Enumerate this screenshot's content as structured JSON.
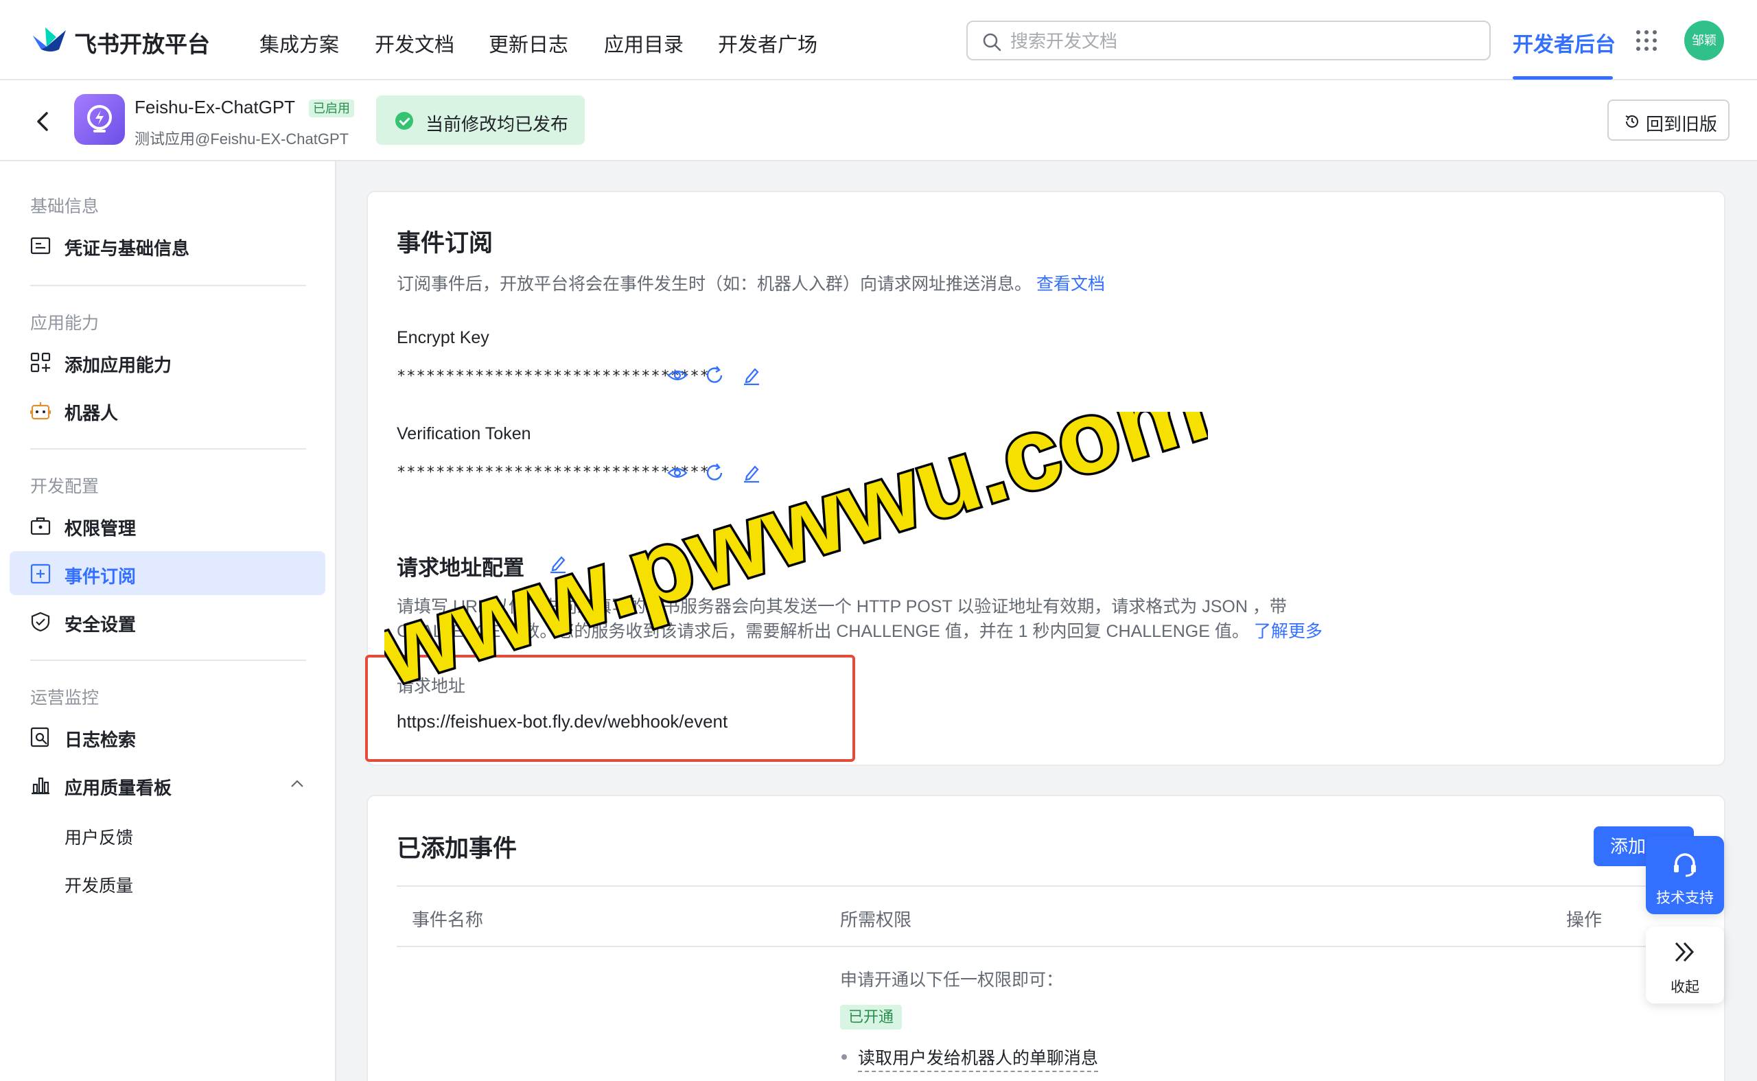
{
  "nav": {
    "brand": "飞书开放平台",
    "items": [
      "集成方案",
      "开发文档",
      "更新日志",
      "应用目录",
      "开发者广场"
    ],
    "search_placeholder": "搜索开发文档",
    "dev_console": "开发者后台",
    "avatar_text": "邹颖"
  },
  "app": {
    "name": "Feishu-Ex-ChatGPT",
    "badge": "已启用",
    "subtitle": "测试应用@Feishu-EX-ChatGPT",
    "status": "当前修改均已发布",
    "old_version": "回到旧版"
  },
  "sidebar": {
    "groups": [
      "基础信息",
      "应用能力",
      "开发配置",
      "运营监控"
    ],
    "items": [
      "凭证与基础信息",
      "添加应用能力",
      "机器人",
      "权限管理",
      "事件订阅",
      "安全设置",
      "日志检索",
      "应用质量看板"
    ],
    "subitems": [
      "用户反馈",
      "开发质量"
    ]
  },
  "event_sub": {
    "title": "事件订阅",
    "desc": "订阅事件后，开放平台将会在事件发生时（如：机器人入群）向请求网址推送消息。",
    "doc_link": "查看文档",
    "encrypt_label": "Encrypt Key",
    "encrypt_mask": "********************************",
    "token_label": "Verification Token",
    "token_mask": "********************************",
    "request_title": "请求地址配置",
    "request_desc1": "请填写 URL 以便飞书向您填写的飞书服务器会向其发送一个 HTTP POST 以验证地址有效期，请求格式为 JSON ，带",
    "request_desc2": "CHALLENGE 参数。您的服务收到该请求后，需要解析出 CHALLENGE 值，并在 1 秒内回复 CHALLENGE 值。",
    "learn_more": "了解更多",
    "url_label": "请求地址",
    "url_value": "https://feishuex-bot.fly.dev/webhook/event"
  },
  "events": {
    "title": "已添加事件",
    "add_button": "添加",
    "columns": [
      "事件名称",
      "所需权限",
      "操作"
    ],
    "perm_intro": "申请开通以下任一权限即可：",
    "perm_tag": "已开通",
    "perm_item": "读取用户发给机器人的单聊消息"
  },
  "float": {
    "support": "技术支持",
    "collapse": "收起"
  },
  "watermark": "www.pwwwu.com",
  "colors": {
    "accent": "#3370ff",
    "success": "#34c471",
    "highlight_border": "#e44b3a",
    "watermark_fill": "#f5e000"
  }
}
